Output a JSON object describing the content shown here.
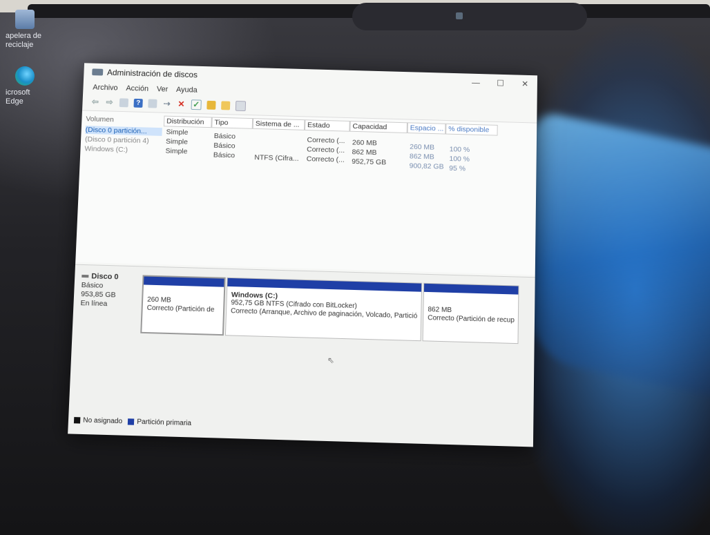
{
  "desktop": {
    "icons": [
      {
        "label": "apelera de reciclaje"
      },
      {
        "label": "icrosoft Edge"
      }
    ]
  },
  "window": {
    "title": "Administración de discos",
    "controls": {
      "minimize": "—",
      "maximize": "☐",
      "close": "✕"
    },
    "menu": [
      "Archivo",
      "Acción",
      "Ver",
      "Ayuda"
    ],
    "toolbar_icons": [
      "back-icon",
      "forward-icon",
      "list-view-icon",
      "help-icon",
      "properties-icon",
      "connect-icon",
      "delete-icon",
      "check-icon",
      "folder-icon",
      "explore-icon",
      "settings-icon"
    ],
    "columns": [
      "Volumen",
      "Distribución",
      "Tipo",
      "Sistema de ...",
      "Estado",
      "Capacidad",
      "Espacio ...",
      "% disponible"
    ],
    "rows": [
      {
        "volume": "(Disco 0 partición...",
        "layout": "Simple",
        "type": "Básico",
        "fs": "",
        "status": "Correcto (...",
        "capacity": "260 MB",
        "free": "260 MB",
        "pct": "100 %"
      },
      {
        "volume": "(Disco 0 partición 4)",
        "layout": "Simple",
        "type": "Básico",
        "fs": "",
        "status": "Correcto (...",
        "capacity": "862 MB",
        "free": "862 MB",
        "pct": "100 %"
      },
      {
        "volume": "Windows (C:)",
        "layout": "Simple",
        "type": "Básico",
        "fs": "NTFS (Cifra...",
        "status": "Correcto (...",
        "capacity": "952,75 GB",
        "free": "900,82 GB",
        "pct": "95 %"
      }
    ],
    "disk": {
      "name": "Disco 0",
      "type": "Básico",
      "size": "953,85 GB",
      "state": "En línea"
    },
    "partitions": [
      {
        "title": "",
        "line1": "260 MB",
        "line2": "Correcto (Partición de"
      },
      {
        "title": "Windows  (C:)",
        "line1": "952,75 GB NTFS (Cifrado con BitLocker)",
        "line2": "Correcto (Arranque, Archivo de paginación, Volcado, Partició"
      },
      {
        "title": "",
        "line1": "862 MB",
        "line2": "Correcto (Partición de recup"
      }
    ],
    "legend": [
      {
        "label": "No asignado",
        "color": "#111111"
      },
      {
        "label": "Partición primaria",
        "color": "#1f3fa6"
      }
    ]
  }
}
